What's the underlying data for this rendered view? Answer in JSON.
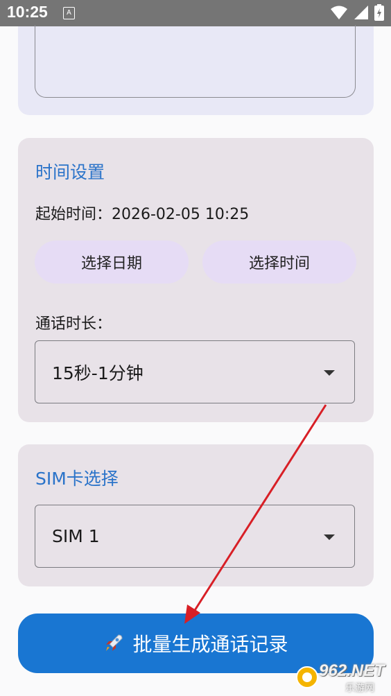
{
  "status_bar": {
    "time": "10:25",
    "notification_glyph": "A"
  },
  "time_settings": {
    "title": "时间设置",
    "start_time_label": "起始时间：2026-02-05 10:25",
    "select_date_label": "选择日期",
    "select_time_label": "选择时间",
    "duration_label": "通话时长：",
    "duration_value": "15秒-1分钟"
  },
  "sim_settings": {
    "title": "SIM卡选择",
    "sim_value": "SIM 1"
  },
  "generate_button": {
    "icon": "rocket-icon",
    "label": "批量生成通话记录"
  },
  "watermark": {
    "text": "962.NET",
    "subtext": "乐游网"
  },
  "colors": {
    "accent": "#2a73c9",
    "button": "#1976d2",
    "pill": "#e6dcf5",
    "arrow": "#d81f26"
  }
}
